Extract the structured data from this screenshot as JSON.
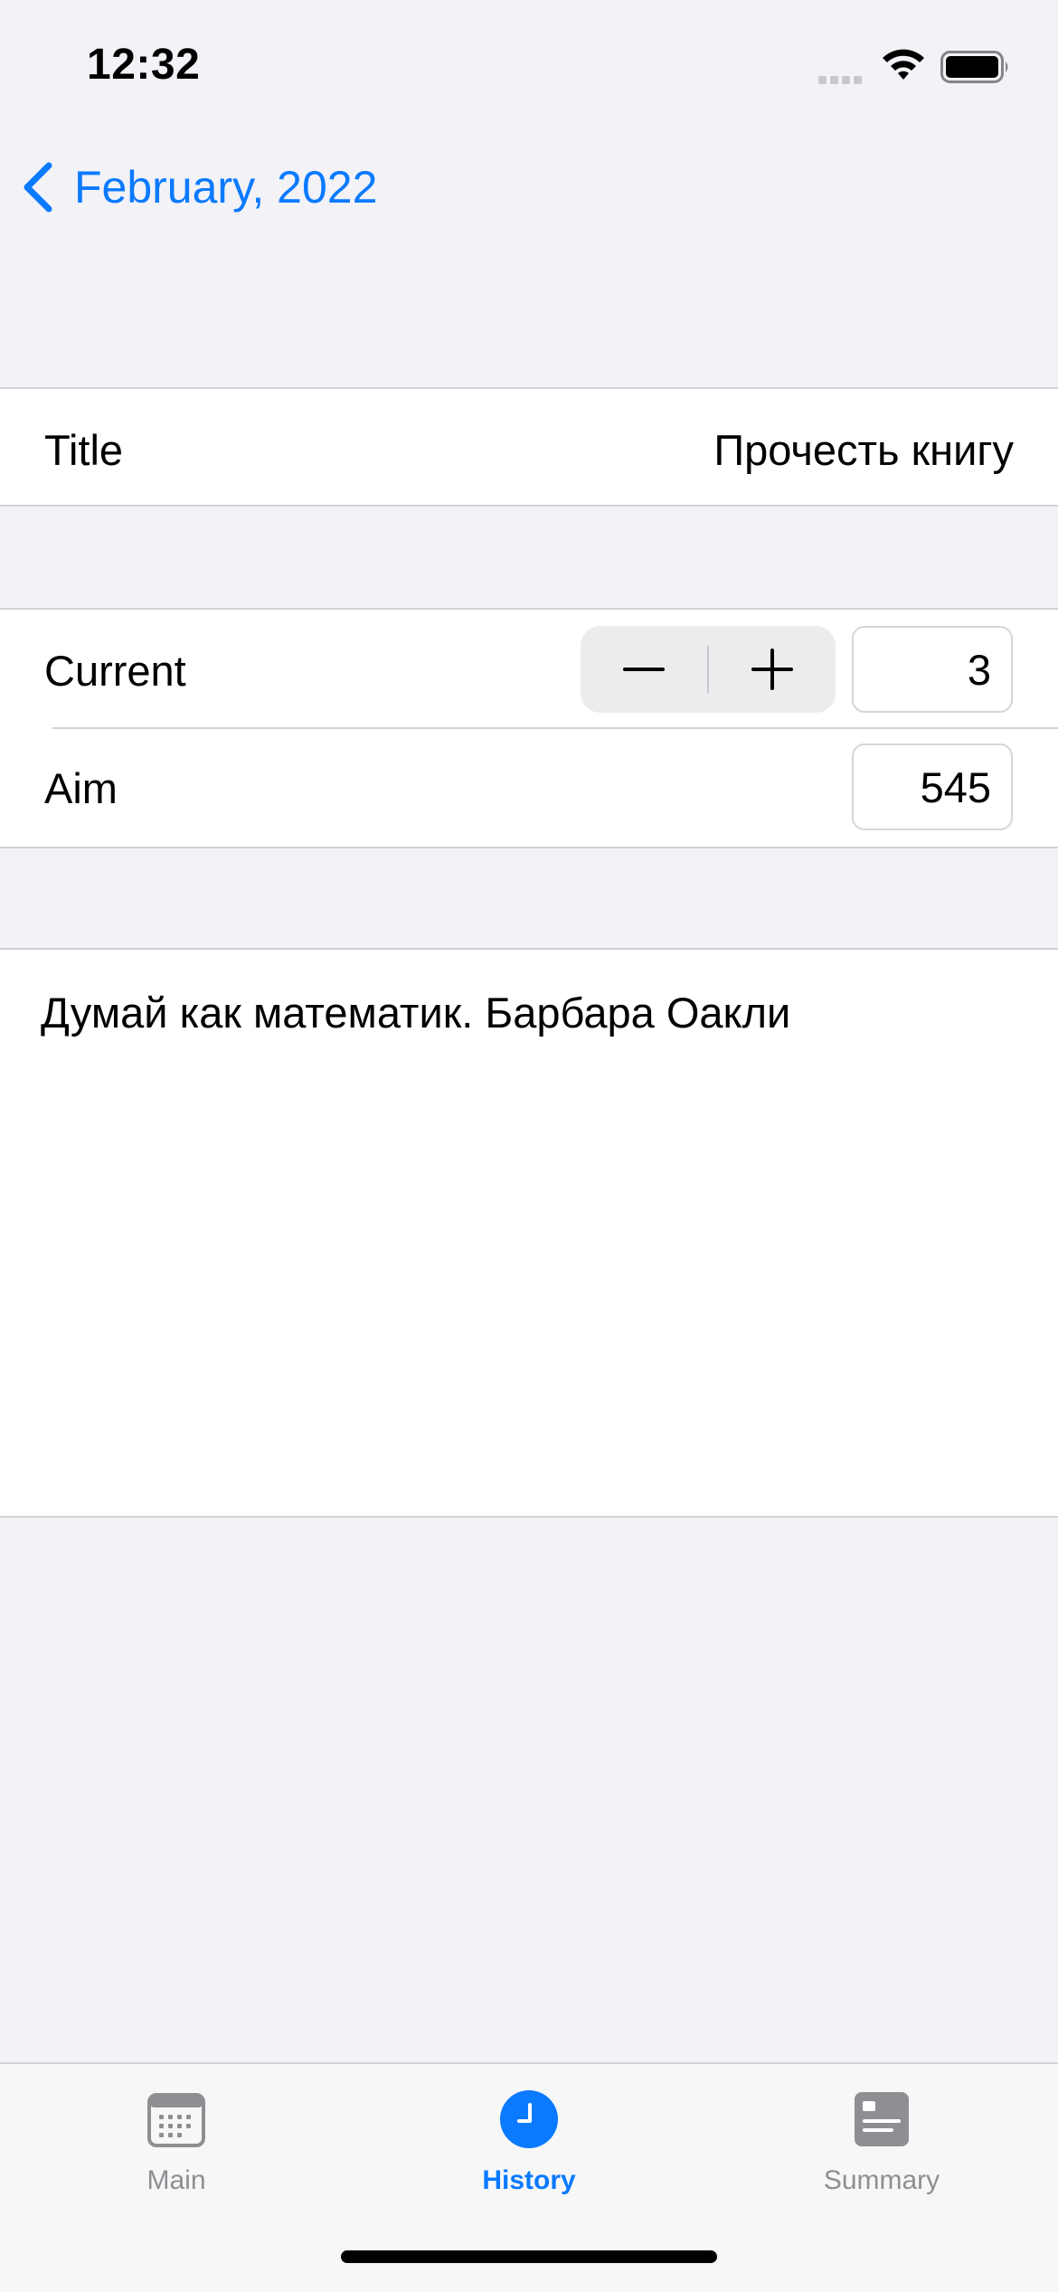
{
  "status_bar": {
    "time": "12:32"
  },
  "nav": {
    "back_label": "February, 2022",
    "accent_color": "#0a7aff"
  },
  "form": {
    "title_row": {
      "label": "Title",
      "value": "Прочесть книгу"
    },
    "current_row": {
      "label": "Current",
      "value": "3",
      "decrement_icon": "minus-icon",
      "increment_icon": "plus-icon"
    },
    "aim_row": {
      "label": "Aim",
      "value": "545"
    },
    "notes": "Думай как математик. Барбара Оакли"
  },
  "tab_bar": {
    "active_color": "#0a7aff",
    "inactive_color": "#8e8e93",
    "tabs": [
      {
        "label": "Main",
        "icon": "calendar-icon",
        "active": false
      },
      {
        "label": "History",
        "icon": "clock-icon",
        "active": true
      },
      {
        "label": "Summary",
        "icon": "summary-card-icon",
        "active": false
      }
    ]
  }
}
